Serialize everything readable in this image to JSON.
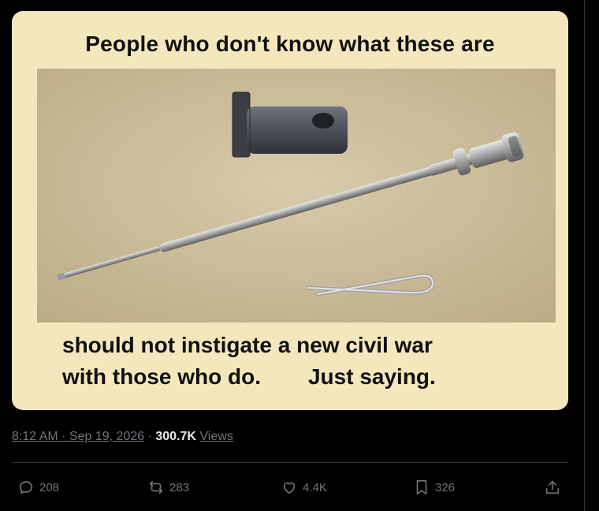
{
  "tweet": {
    "image": {
      "caption_top": "People who don't know what these are",
      "caption_bottom_line1": "should not instigate a new civil war",
      "caption_bottom_line2a": "with those who do.",
      "caption_bottom_line2b": "Just saying.",
      "depicted_items": [
        "firing-pin-retaining-pin",
        "firing-pin",
        "cotter-pin"
      ]
    },
    "meta": {
      "time": "8:12 AM",
      "separator": "·",
      "date": "Sep 19, 2026",
      "views_count": "300.7K",
      "views_label": "Views"
    },
    "actions": {
      "replies": "208",
      "reposts": "283",
      "likes": "4.4K",
      "bookmarks": "326"
    },
    "colors": {
      "background": "#000000",
      "meme_background": "#f4e7bd",
      "muted_text": "#71767b",
      "divider": "#2f3336"
    }
  }
}
